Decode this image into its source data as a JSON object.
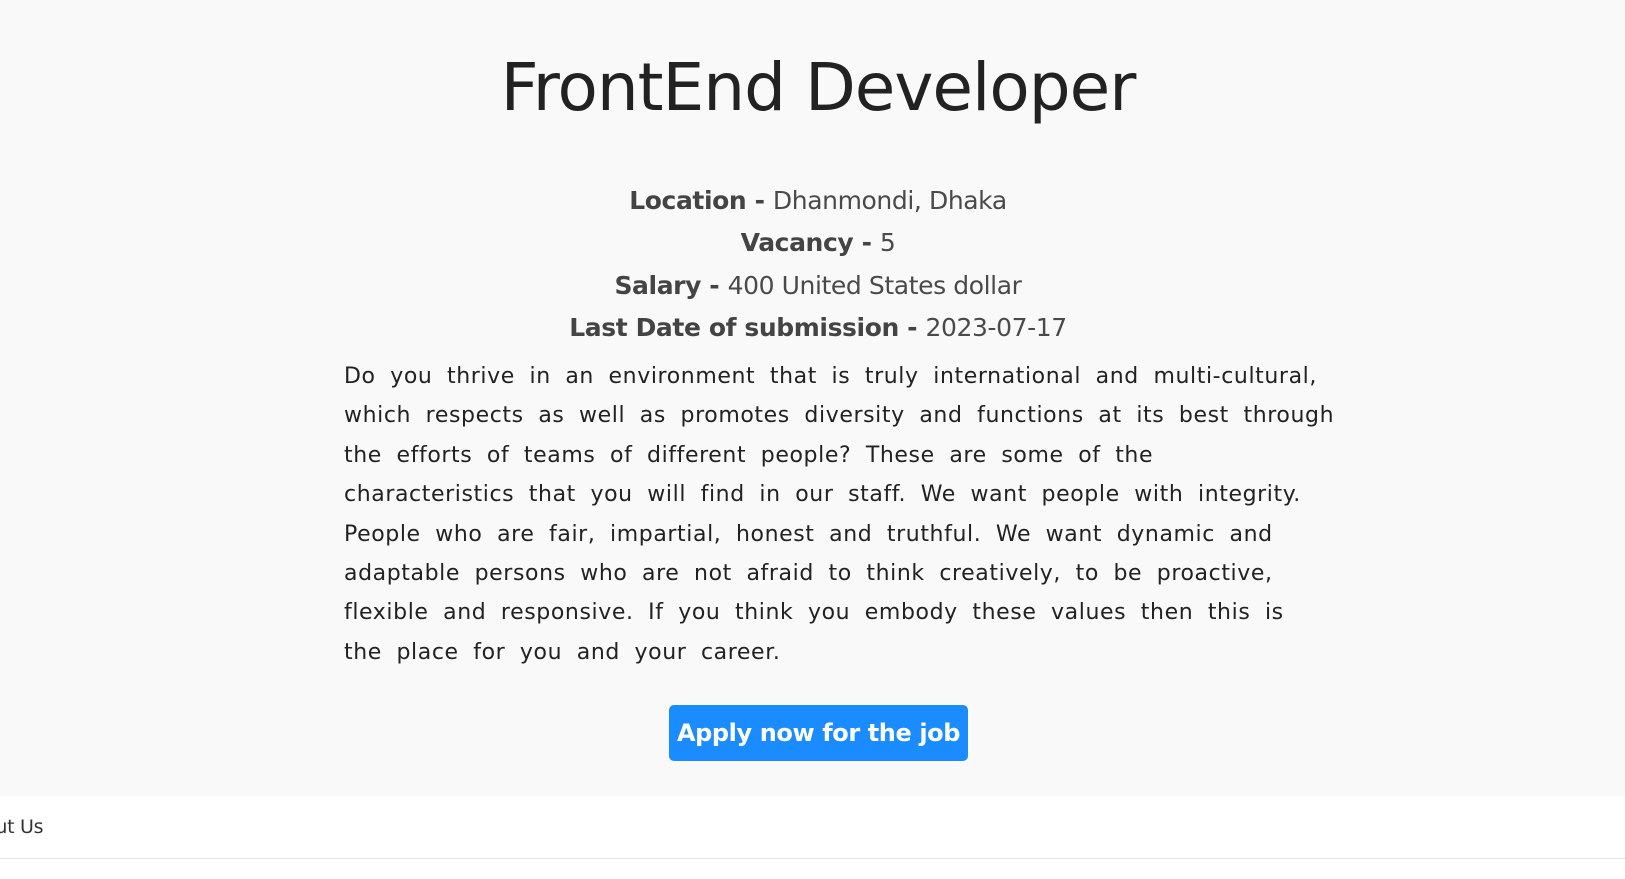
{
  "job": {
    "title": "FrontEnd Developer",
    "details": [
      {
        "label": "Location - ",
        "value": "Dhanmondi, Dhaka"
      },
      {
        "label": "Vacancy - ",
        "value": "5"
      },
      {
        "label": "Salary - ",
        "value": "400 United States dollar"
      },
      {
        "label": "Last Date of submission - ",
        "value": "2023-07-17"
      }
    ],
    "description_lines": [
      "Do you thrive in an environment that is truly international and multi-cultural,",
      "which respects as well as promotes diversity and functions at its best through",
      "the efforts of teams of different people? These are some of the",
      "characteristics that you will find in our staff. We want people with integrity.",
      "People who are fair, impartial, honest and truthful. We want dynamic and",
      "adaptable persons who are not afraid to think creatively, to be proactive,",
      "flexible and responsive. If you think you embody these values then this is",
      "the place for you and your career."
    ],
    "apply_label": "Apply now for the job"
  },
  "footer": {
    "about_label": "out Us"
  },
  "colors": {
    "page_background": "#f9f9f9",
    "footer_background": "#ffffff",
    "button_background": "#1a8cff",
    "button_text": "#ffffff",
    "title_text": "#222222"
  }
}
